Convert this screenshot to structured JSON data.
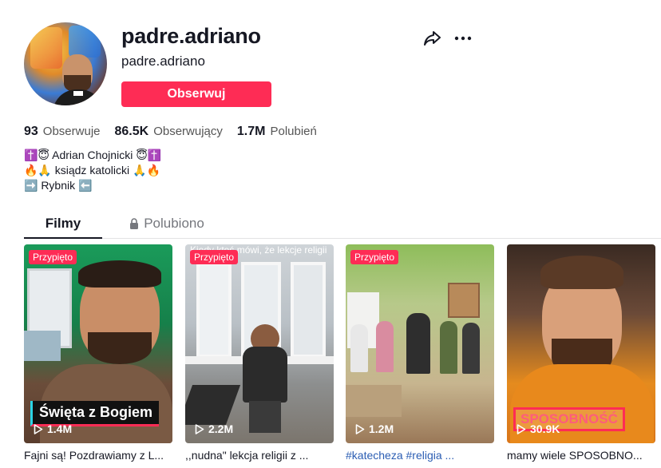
{
  "profile": {
    "username": "padre.adriano",
    "nickname": "padre.adriano",
    "follow_label": "Obserwuj"
  },
  "stats": [
    {
      "value": "93",
      "label": "Obserwuje"
    },
    {
      "value": "86.5K",
      "label": "Obserwujący"
    },
    {
      "value": "1.7M",
      "label": "Polubień"
    }
  ],
  "bio": [
    "✝️😇 Adrian Chojnicki 😇✝️",
    "🔥🙏 ksiądz katolicki 🙏🔥",
    "➡️ Rybnik ⬅️"
  ],
  "tabs": {
    "films": "Filmy",
    "liked": "Polubiono"
  },
  "videos": [
    {
      "pinned": "Przypięto",
      "views": "1.4M",
      "overlay": "Święta z Bogiem",
      "caption": "Fajni są! Pozdrawiamy z L..."
    },
    {
      "pinned": "Przypięto",
      "views": "2.2M",
      "overlay": "Kiedy ktoś mówi, że lekcje religii są nudne",
      "caption": ",,nudna\" lekcja religii z ..."
    },
    {
      "pinned": "Przypięto",
      "views": "1.2M",
      "overlay": "",
      "caption": "#katecheza #religia ..."
    },
    {
      "pinned": "",
      "views": "30.9K",
      "overlay": "SPOSOBNOŚĆ",
      "caption": "mamy wiele SPOSOBNO..."
    }
  ],
  "colors": {
    "accent": "#fe2c55",
    "text": "#161823",
    "hashtag": "#2b5db3"
  },
  "icons": {
    "share": "share-arrow-icon",
    "more": "more-dots-icon",
    "lock": "lock-icon",
    "play": "play-icon"
  }
}
